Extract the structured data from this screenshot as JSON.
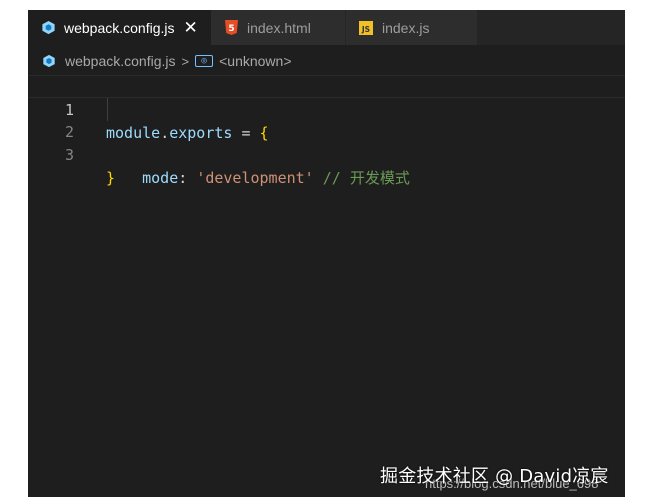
{
  "tabs": [
    {
      "label": "webpack.config.js",
      "icon": "webpack-icon",
      "active": true,
      "close": "✕"
    },
    {
      "label": "index.html",
      "icon": "html5-icon",
      "active": false
    },
    {
      "label": "index.js",
      "icon": "js-icon",
      "active": false
    }
  ],
  "breadcrumb": {
    "file": "webpack.config.js",
    "separator": ">",
    "symbol": "<unknown>"
  },
  "code": {
    "lines": [
      {
        "number": "1",
        "tokens": [
          "module",
          ".",
          "exports",
          " = ",
          "{"
        ]
      },
      {
        "number": "2",
        "tokens": [
          "    mode",
          ": ",
          "'development'",
          " // 开发模式"
        ]
      },
      {
        "number": "3",
        "tokens": [
          "}"
        ]
      }
    ]
  },
  "watermark": {
    "text": "掘金技术社区 @ David凉宸",
    "url": "https://blog.csdn.net/blue_698"
  },
  "colors": {
    "editor_bg": "#1e1e1e",
    "tab_bar_bg": "#252526",
    "string": "#ce9178",
    "comment": "#6a9955",
    "variable": "#9cdcfe",
    "brace": "#ffd700"
  }
}
